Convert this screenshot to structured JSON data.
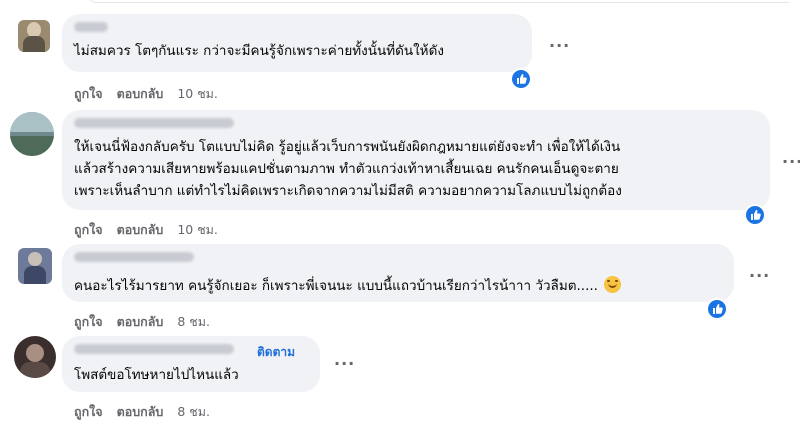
{
  "comments": [
    {
      "text": [
        "ไม่สมควร โตๆกันแระ กว่าจะมีคนรู้จักเพราะค่ายทั้งนั้นที่ดันให้ดัง"
      ],
      "like_label": "ถูกใจ",
      "reply_label": "ตอบกลับ",
      "time": "10 ชม.",
      "has_reaction": true
    },
    {
      "text": [
        "ให้เจนนี่ฟ้องกลับครับ โตแบบไม่คิด รู้อยู่แล้วเว็บการพนันยังผิดกฎหมายแต่ยังจะทำ เพื่อให้ได้เงิน",
        "แล้วสร้างความเสียหายพร้อมแคปชั่นตามภาพ ทำตัวแกว่งเท้าหาเสี้ยนเฉย คนรักคนเอ็นดูจะตาย",
        "เพราะเห็นลำบาก แต่ทำไรไม่คิดเพราะเกิดจากความไม่มีสติ ความอยากความโลภแบบไม่ถูกต้อง"
      ],
      "like_label": "ถูกใจ",
      "reply_label": "ตอบกลับ",
      "time": "10 ชม.",
      "has_reaction": true
    },
    {
      "text": [
        "คนอะไรไร้มารยาท คนรู้จักเยอะ ก็เพราะพี่เจนนะ แบบนี้แถวบ้านเรียกว่าไรน้าาา วัวลืมต..... "
      ],
      "like_label": "ถูกใจ",
      "reply_label": "ตอบกลับ",
      "time": "8 ชม.",
      "has_reaction": true,
      "emoji": "smiling-face-emoji"
    },
    {
      "follow_label": "ติดตาม",
      "text": [
        "โพสต์ขอโทษหายไปไหนแล้ว"
      ],
      "like_label": "ถูกใจ",
      "reply_label": "ตอบกลับ",
      "time": "8 ชม.",
      "has_reaction": false
    }
  ],
  "more_glyph": "···",
  "colors": {
    "bubble": "#f0f2f5",
    "link": "#216fdb",
    "meta": "#65676b",
    "reaction": "#1b74e4"
  },
  "icons": {
    "more": "more-horizontal-icon",
    "reaction": "like-reaction-icon"
  }
}
